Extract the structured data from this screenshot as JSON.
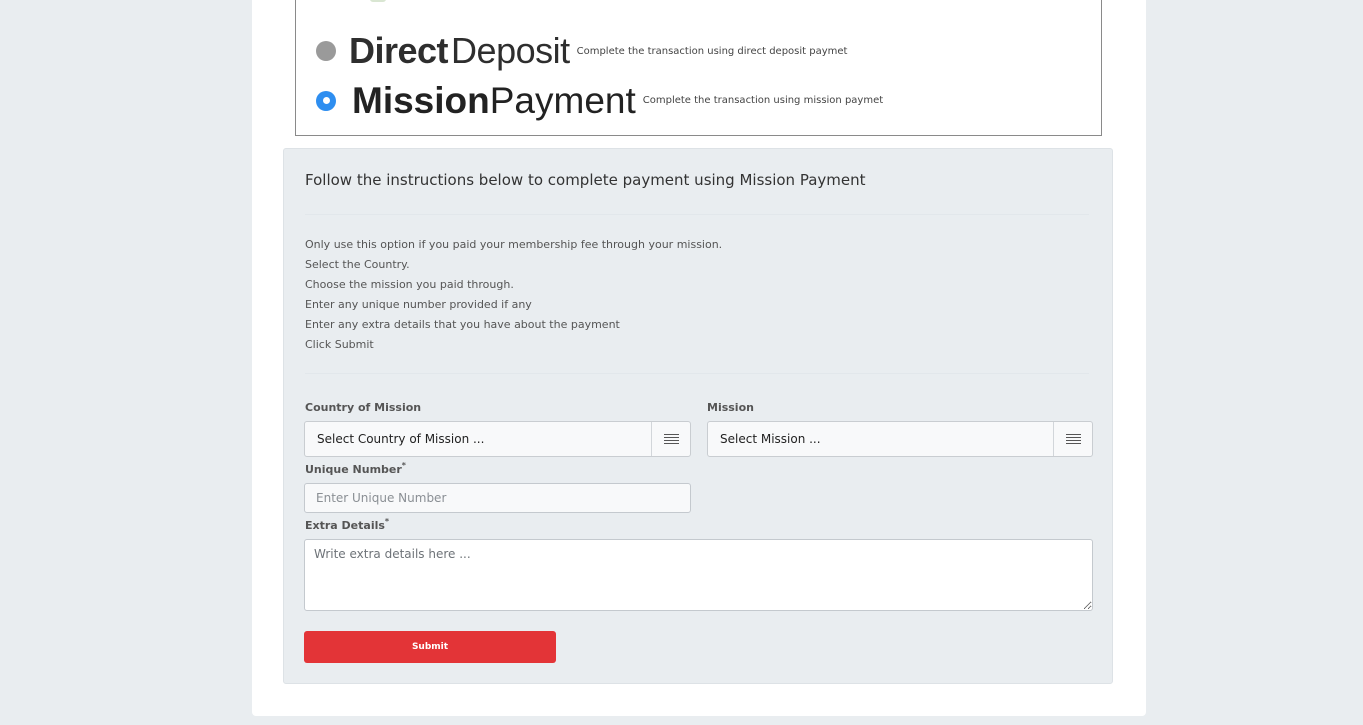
{
  "payment_options": {
    "direct_deposit": {
      "logo_bold": "Direct",
      "logo_light": "Deposit",
      "description": "Complete the transaction using direct deposit paymet",
      "selected": false
    },
    "mission_payment": {
      "logo_bold": "Mission",
      "logo_light": "Payment",
      "description": "Complete the transaction using mission paymet",
      "selected": true
    }
  },
  "instructions": {
    "title": "Follow the instructions below to complete payment using Mission Payment",
    "steps": [
      "Only use this option if you paid your membership fee through your mission.",
      "Select the Country.",
      "Choose the mission you paid through.",
      "Enter any unique number provided if any",
      "Enter any extra details that you have about the payment",
      "Click Submit"
    ]
  },
  "form": {
    "country_label": "Country of Mission",
    "country_value": "Select Country of Mission ...",
    "mission_label": "Mission",
    "mission_value": "Select Mission ...",
    "unique_label": "Unique Number",
    "unique_placeholder": "Enter Unique Number",
    "extra_label": "Extra Details",
    "extra_placeholder": "Write extra details here ...",
    "required_mark": "*",
    "submit_label": "Submit"
  },
  "colors": {
    "accent_blue": "#2e8ef0",
    "submit_red": "#e33437",
    "radio_gray": "#9a9a9a"
  },
  "icons": {
    "select_handle": "list-icon"
  }
}
